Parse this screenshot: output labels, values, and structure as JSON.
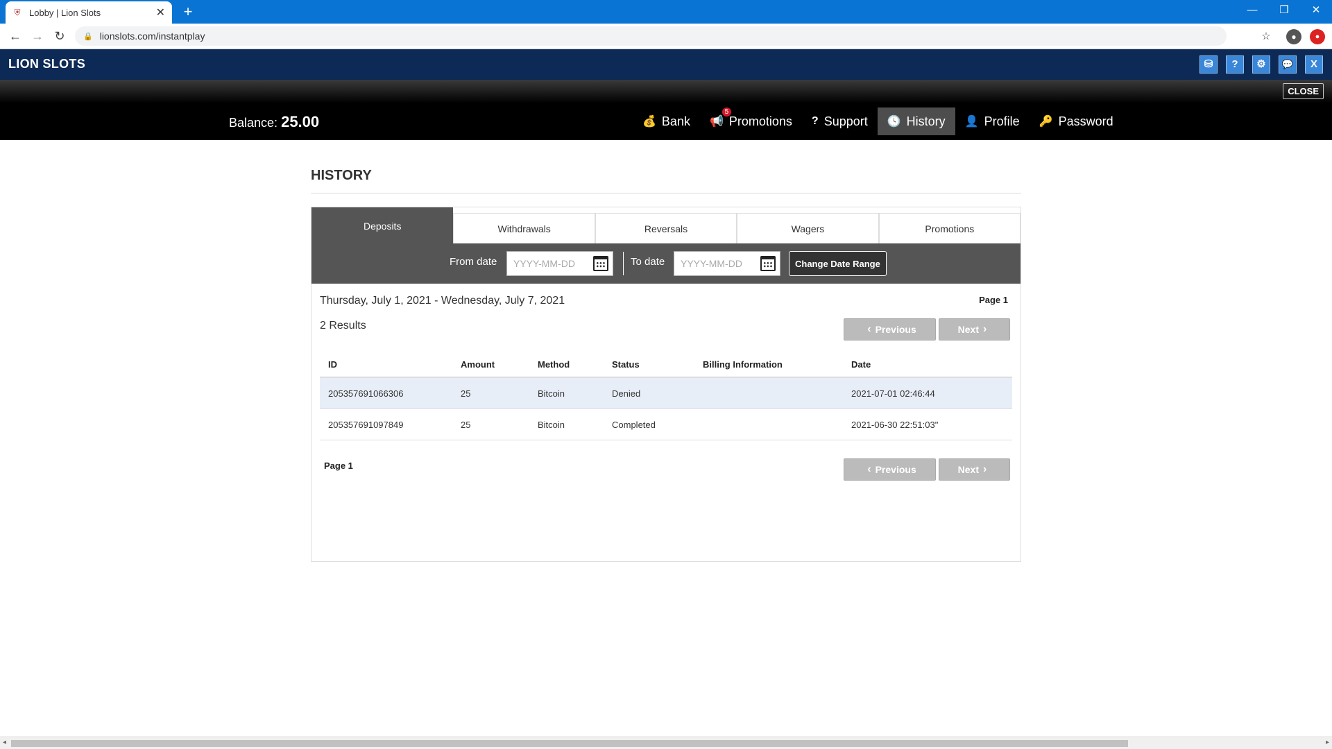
{
  "browser": {
    "tab_title": "Lobby | Lion Slots",
    "tab_close": "✕",
    "new_tab": "+",
    "url": "lionslots.com/instantplay",
    "controls": {
      "minimize": "—",
      "restore": "❐",
      "close": "✕"
    },
    "nav": {
      "back": "←",
      "forward": "→",
      "reload": "↻"
    }
  },
  "app": {
    "brand": "LION SLOTS",
    "header_icons": [
      {
        "name": "bank-icon",
        "glyph": "⛁"
      },
      {
        "name": "help-icon",
        "glyph": "?"
      },
      {
        "name": "gear-icon",
        "glyph": "⚙"
      },
      {
        "name": "chat-icon",
        "glyph": "💬"
      },
      {
        "name": "close-x-icon",
        "glyph": "X"
      }
    ],
    "close_label": "CLOSE",
    "balance_label": "Balance:",
    "balance_value": "25.00",
    "menu": [
      {
        "id": "bank",
        "label": "Bank",
        "icon": "bank-icon",
        "glyph": "💰"
      },
      {
        "id": "promotions",
        "label": "Promotions",
        "icon": "megaphone-icon",
        "glyph": "📢",
        "badge": "5"
      },
      {
        "id": "support",
        "label": "Support",
        "icon": "question-icon",
        "glyph": "?"
      },
      {
        "id": "history",
        "label": "History",
        "icon": "clock-icon",
        "glyph": "🕓",
        "active": true
      },
      {
        "id": "profile",
        "label": "Profile",
        "icon": "user-icon",
        "glyph": "👤"
      },
      {
        "id": "password",
        "label": "Password",
        "icon": "key-icon",
        "glyph": "🔑"
      }
    ]
  },
  "history": {
    "title": "HISTORY",
    "tabs": [
      "Deposits",
      "Withdrawals",
      "Reversals",
      "Wagers",
      "Promotions"
    ],
    "active_tab": "Deposits",
    "filter": {
      "from_label": "From date",
      "from_placeholder": "YYYY-MM-DD",
      "to_label": "To date",
      "to_placeholder": "YYYY-MM-DD",
      "change_range_label": "Change Date Range"
    },
    "date_range": "Thursday, July 1, 2021 - Wednesday, July 7, 2021",
    "page_label": "Page 1",
    "results": "2 Results",
    "pager": {
      "previous": "Previous",
      "next": "Next"
    },
    "columns": [
      "ID",
      "Amount",
      "Method",
      "Status",
      "Billing Information",
      "Date"
    ],
    "rows": [
      {
        "id": "205357691066306",
        "amount": "25",
        "method": "Bitcoin",
        "status": "Denied",
        "billing": "",
        "date": "2021-07-01 02:46:44"
      },
      {
        "id": "205357691097849",
        "amount": "25",
        "method": "Bitcoin",
        "status": "Completed",
        "billing": "",
        "date": "2021-06-30 22:51:03\""
      }
    ]
  }
}
